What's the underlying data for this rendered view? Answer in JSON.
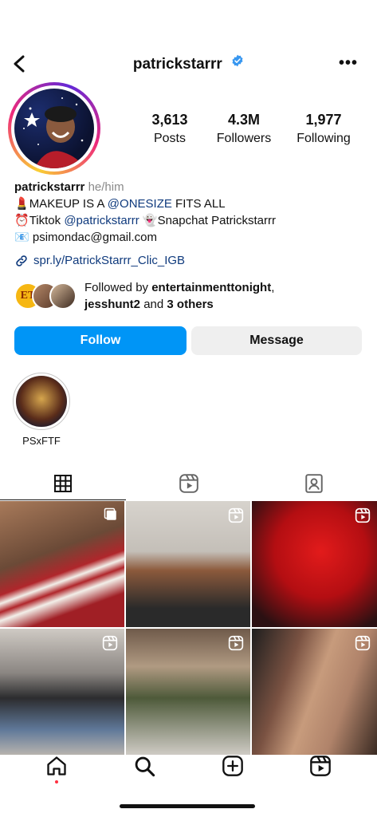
{
  "header": {
    "username": "patrickstarrr"
  },
  "stats": [
    {
      "value": "3,613",
      "label": "Posts"
    },
    {
      "value": "4.3M",
      "label": "Followers"
    },
    {
      "value": "1,977",
      "label": "Following"
    }
  ],
  "bio": {
    "name": "patrickstarrr",
    "pronouns": "he/him",
    "line1_prefix": "MAKEUP IS A ",
    "line1_mention": "@ONESIZE",
    "line1_suffix": " FITS ALL",
    "line2_prefix": "Tiktok ",
    "line2_mention": "@patrickstarrr",
    "line2_suffix": "Snapchat Patrickstarrr",
    "line3": "psimondac@gmail.com",
    "link": "spr.ly/PatrickStarrr_Clic_IGB"
  },
  "followed": {
    "prefix": "Followed by ",
    "user1": "entertainmenttonight",
    "sep": ",",
    "user2": "jesshunt2",
    "middle": " and ",
    "others": "3 others",
    "badge": "ET"
  },
  "buttons": {
    "follow": "Follow",
    "message": "Message"
  },
  "highlights": [
    {
      "label": "PSxFTF"
    }
  ],
  "tabs": [
    "grid-icon",
    "reels-icon",
    "tagged-icon"
  ],
  "icons": [
    "back-icon",
    "verified-icon",
    "more-icon",
    "link-icon",
    "home-icon",
    "search-icon",
    "create-icon",
    "reels-icon"
  ],
  "colors": {
    "accent": "#0095f6",
    "link": "#0f3a7d",
    "verified": "#3897f0",
    "notification": "#ff3040"
  }
}
